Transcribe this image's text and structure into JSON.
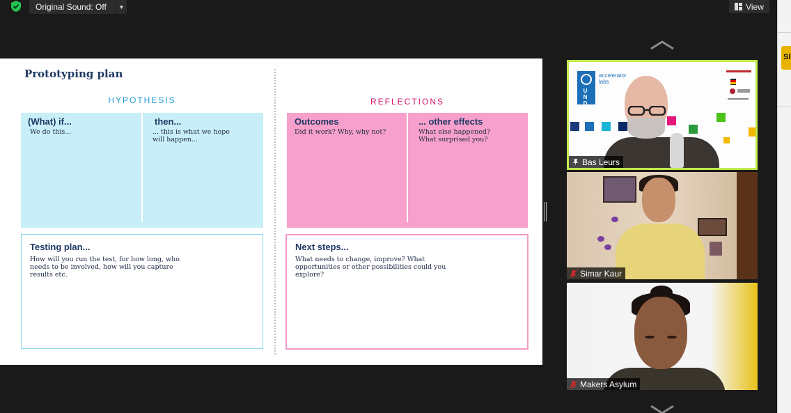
{
  "toolbar": {
    "original_sound_label": "Original Sound: Off",
    "view_label": "View"
  },
  "side_strip": {
    "chip_text": "Sl"
  },
  "slide": {
    "title": "Prototyping plan",
    "hypothesis_heading": "HYPOTHESIS",
    "reflections_heading": "REFLECTIONS",
    "what_if": {
      "heading": "(What) if...",
      "text": "We do this..."
    },
    "then": {
      "heading": "then...",
      "text_line1": "... this is what we hope",
      "text_line2": "will happen..."
    },
    "outcomes": {
      "heading": "Outcomes",
      "text": "Did it work? Why, why not?"
    },
    "other_effects": {
      "heading": "... other effects",
      "text_line1": "What else happened?",
      "text_line2": "What surprised you?"
    },
    "testing_plan": {
      "heading": "Testing plan...",
      "text_line1": "How will you run the test, for how long, who",
      "text_line2": "needs to be involved, how will you capture",
      "text_line3": "results etc."
    },
    "next_steps": {
      "heading": "Next steps...",
      "text_line1": "What needs to change, improve? What",
      "text_line2": "opportunities or other possibilities could you",
      "text_line3": "explore?"
    }
  },
  "participants": [
    {
      "name": "Bas Leurs",
      "logo_letters": "U N D P",
      "logo_text_line1": "accelerator",
      "logo_text_line2": "labs"
    },
    {
      "name": "Simar Kaur"
    },
    {
      "name": "Makers Asylum"
    }
  ],
  "colors": {
    "hypothesis_fill": "#c8eef8",
    "reflections_fill": "#f7a0cc",
    "active_speaker_border": "#c2e84c",
    "title_navy": "#1f3864"
  }
}
